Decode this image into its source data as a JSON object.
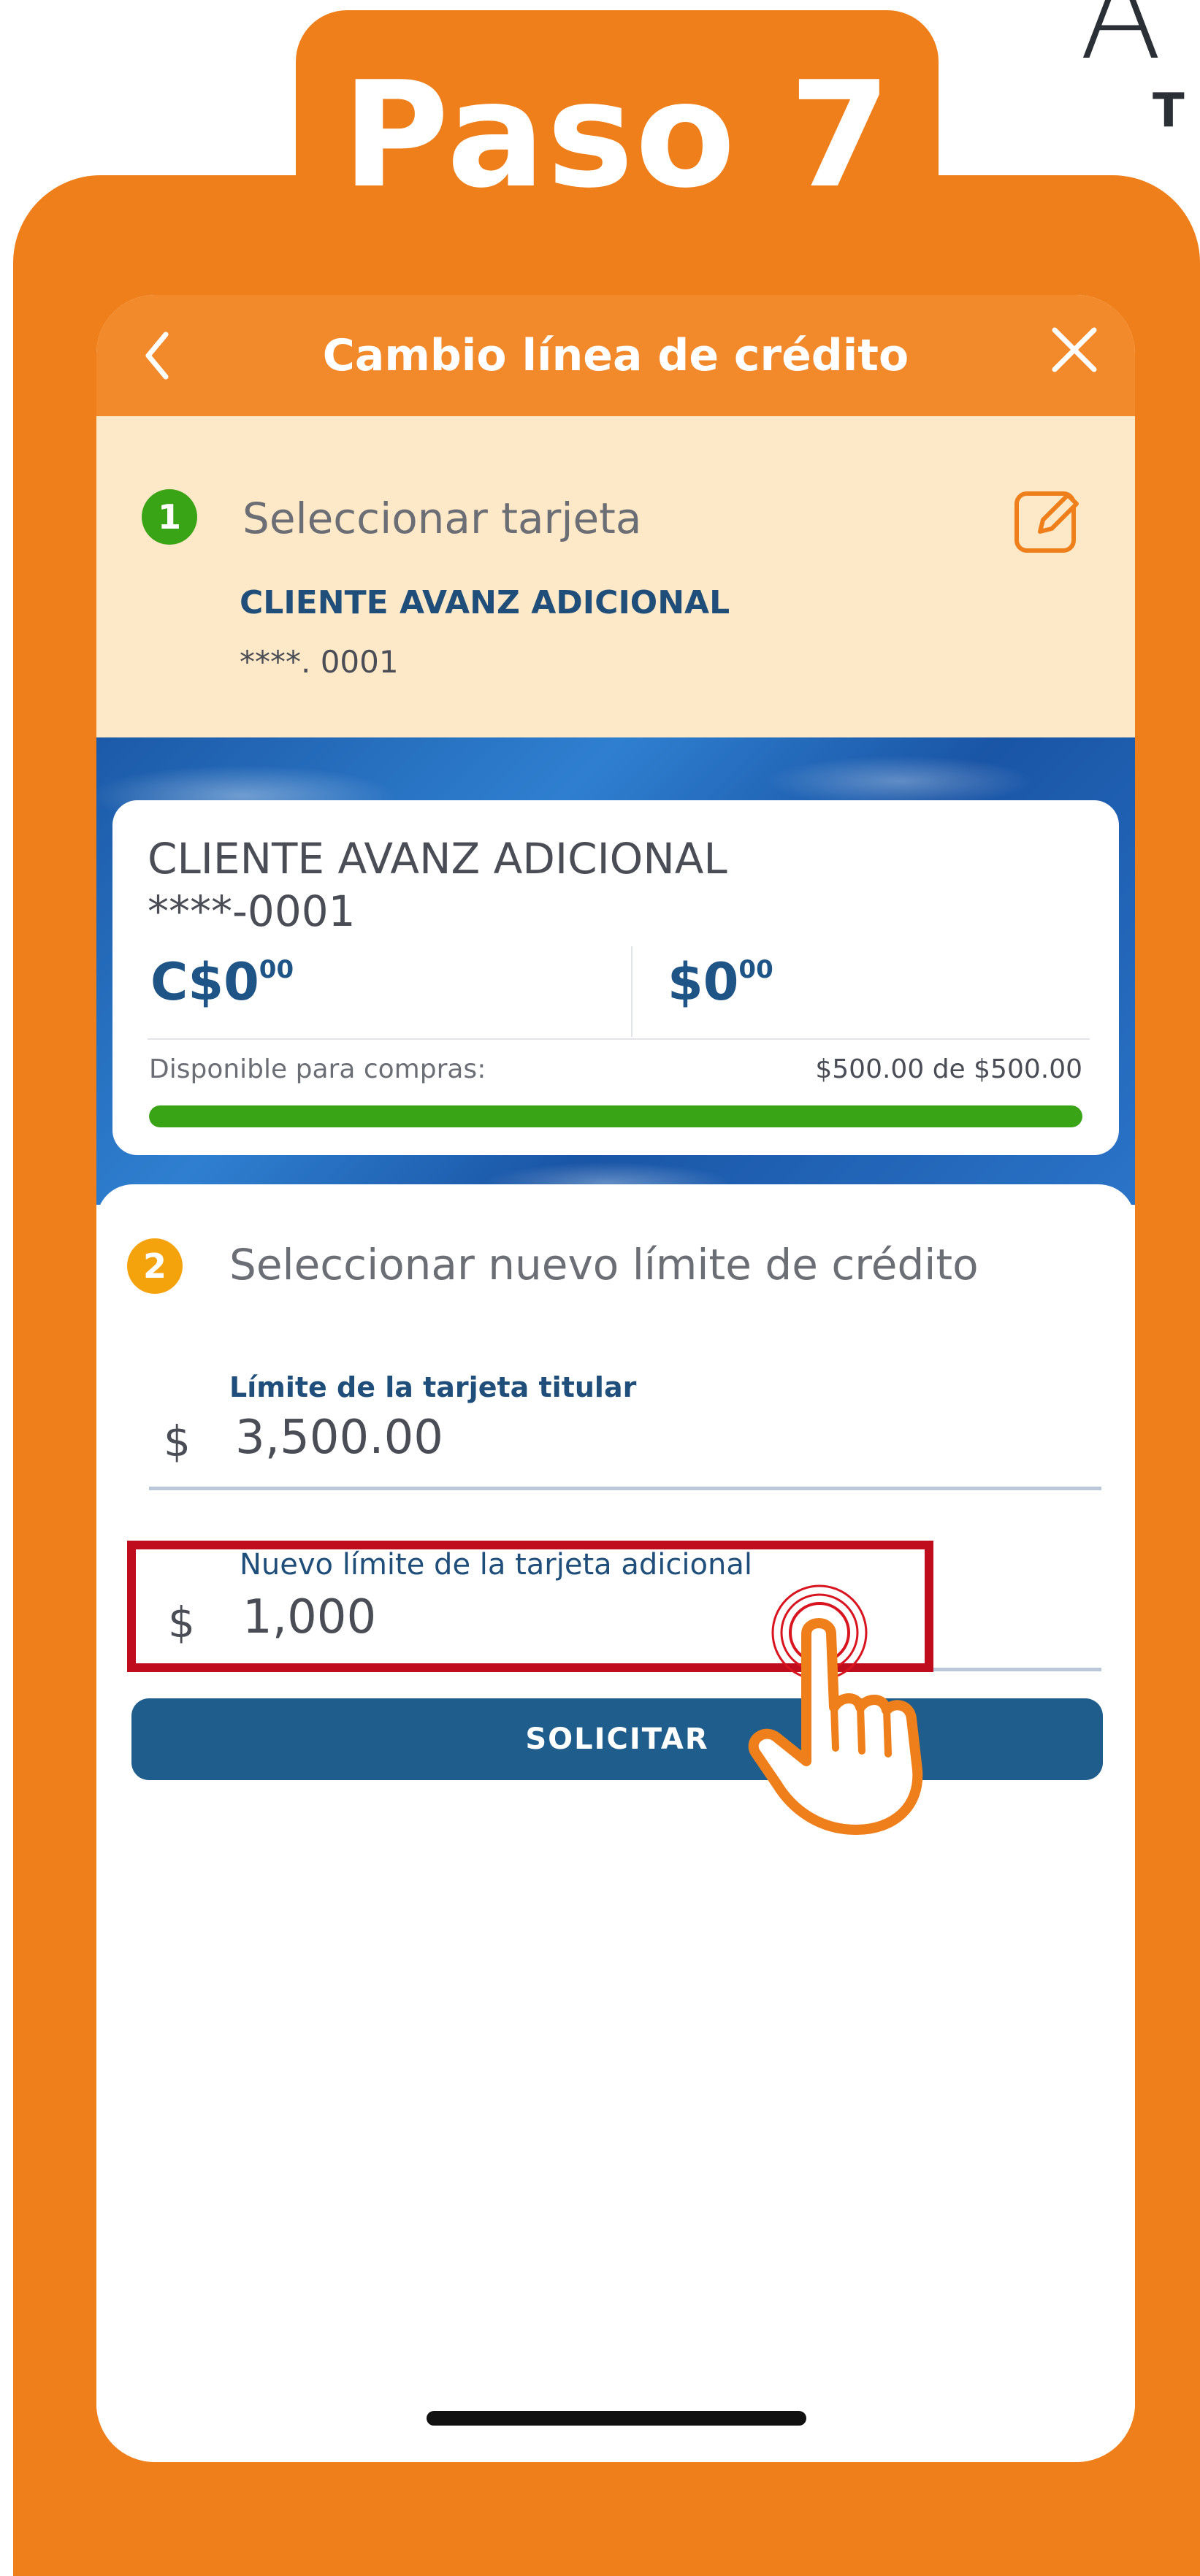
{
  "corner": {
    "big": "A",
    "small": "T"
  },
  "step_badge": {
    "title": "Paso 7"
  },
  "header": {
    "title": "Cambio línea de crédito",
    "back_icon": "chevron-left-icon",
    "close_icon": "close-icon"
  },
  "step1": {
    "number": "1",
    "label": "Seleccionar tarjeta",
    "card_name": "CLIENTE AVANZ ADICIONAL",
    "card_number": "****. 0001",
    "edit_icon": "edit-icon"
  },
  "card": {
    "name": "CLIENTE AVANZ ADICIONAL",
    "number": "****-0001",
    "balance_local": "C$0",
    "balance_local_cents": "00",
    "balance_usd": "$0",
    "balance_usd_cents": "00",
    "available_label": "Disponible para compras:",
    "available_value": "$500.00 de $500.00",
    "available_fraction": 1.0
  },
  "step2": {
    "number": "2",
    "label": "Seleccionar nuevo límite de crédito",
    "titular_limit_label": "Límite de la tarjeta titular",
    "currency_symbol": "$",
    "titular_limit_value": "3,500.00",
    "new_limit_label": "Nuevo límite de la tarjeta adicional",
    "new_limit_value": "1,000",
    "submit_label": "SOLICITAR"
  },
  "colors": {
    "brand_orange": "#ef7f1a",
    "header_orange": "#f28a2b",
    "step1_bg": "#fde8c8",
    "primary_blue": "#1f5e8c",
    "success_green": "#3aa417",
    "highlight_red": "#c00d1e"
  }
}
